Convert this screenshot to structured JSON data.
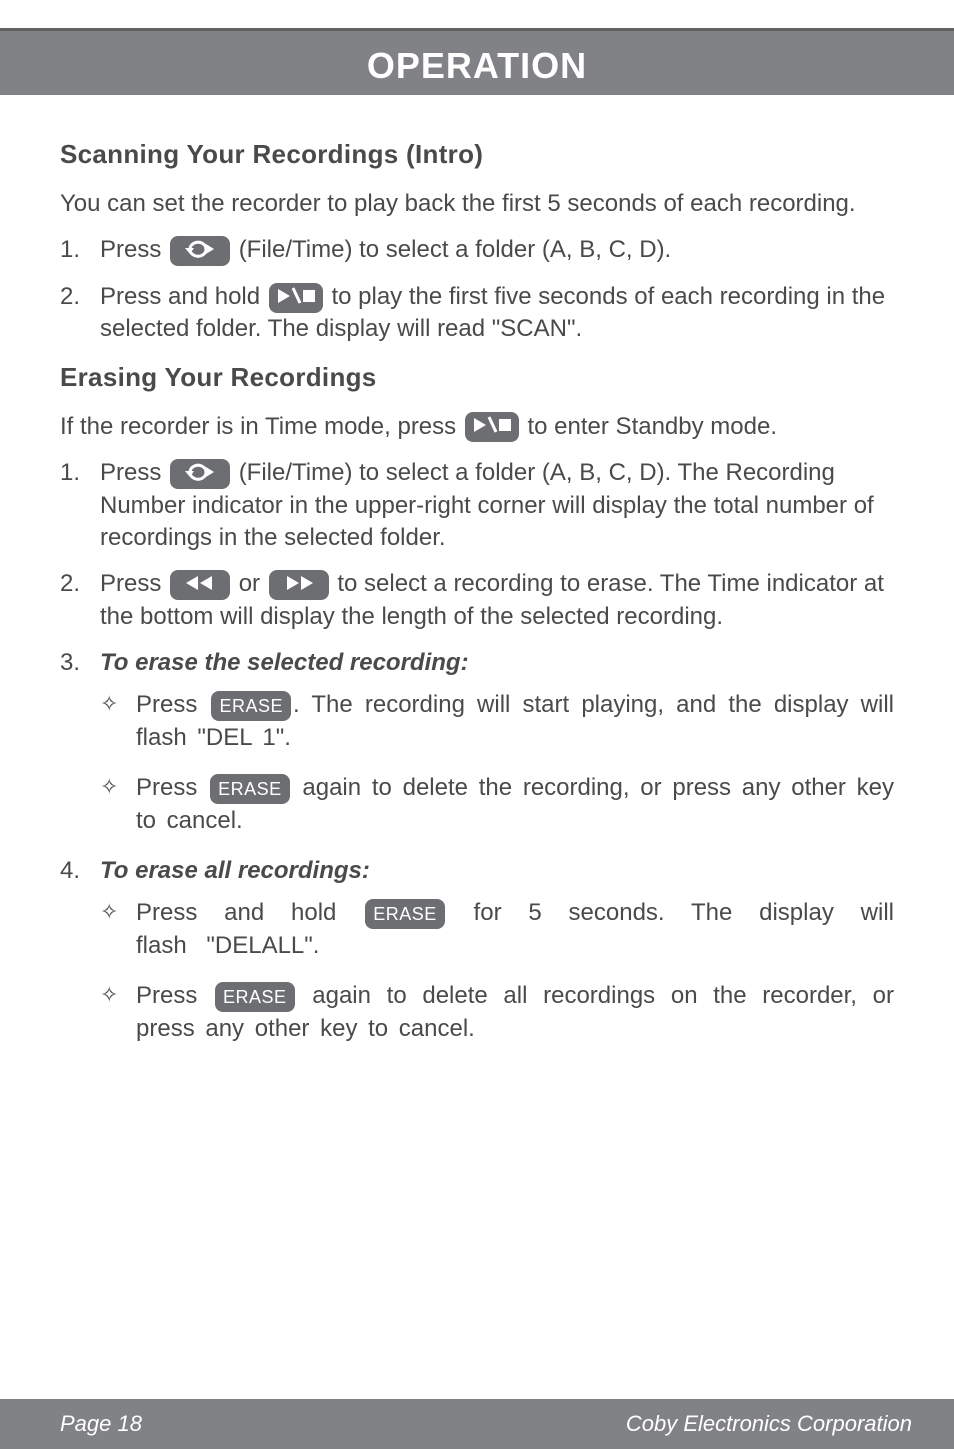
{
  "header": {
    "title": "OPERATION"
  },
  "section1": {
    "heading": "Scanning Your Recordings (Intro)",
    "intro": "You can set the recorder to play back the first 5 seconds of each recording.",
    "li1_a": "Press ",
    "li1_b": " (File/Time) to select a folder (A, B, C, D).",
    "li2_a": "Press and hold ",
    "li2_b": " to play the first five seconds of each recording in the selected folder. The display will read \"SCAN\"."
  },
  "section2": {
    "heading": "Erasing Your Recordings",
    "intro_a": "If the recorder is in Time mode, press ",
    "intro_b": " to enter Standby mode.",
    "li1_a": "Press ",
    "li1_b": " (File/Time) to select a folder (A, B, C, D). The Recording Number indicator in the upper-right corner will display the total number of recordings in the selected folder.",
    "li2_a": "Press ",
    "li2_or": " or ",
    "li2_b": " to select a recording to erase. The Time indicator at the bottom will display the length of the selected recording.",
    "li3_title": "To erase the selected recording:",
    "li3_s1_a": "Press ",
    "li3_s1_b": ". The recording will start playing, and the display will flash \"DEL 1\".",
    "li3_s2_a": "Press ",
    "li3_s2_b": " again to delete the recording, or press any other key to cancel.",
    "li4_title": "To erase all recordings:",
    "li4_s1_a": "Press and hold ",
    "li4_s1_b": " for 5 seconds. The display will flash \"DELALL\".",
    "li4_s2_a": "Press ",
    "li4_s2_b": " again to delete all recordings on the recorder, or press any other key to cancel."
  },
  "buttons": {
    "erase": "ERASE"
  },
  "footer": {
    "page": "Page 18",
    "company": "Coby Electronics Corporation"
  }
}
